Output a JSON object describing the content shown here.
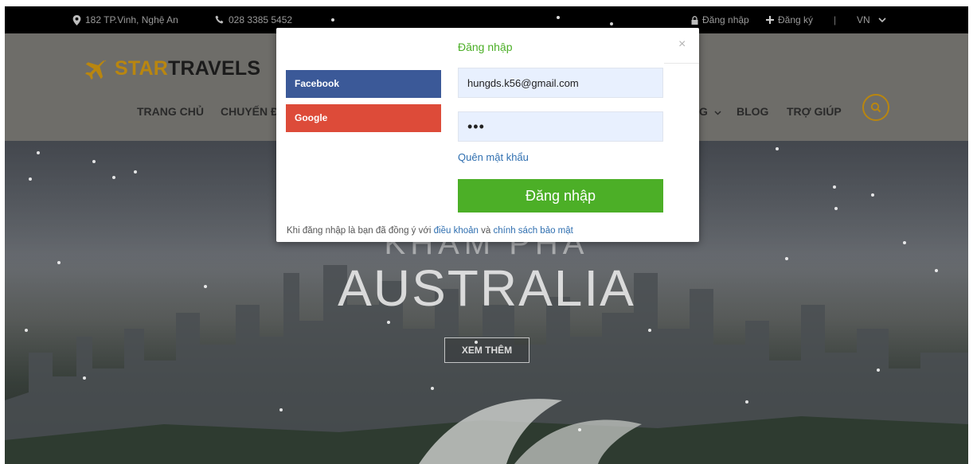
{
  "topbar": {
    "address": "182 TP.Vinh, Nghệ An",
    "phone": "028 3385 5452",
    "login": "Đăng nhập",
    "register": "Đăng ký",
    "separator": "|",
    "language": "VN"
  },
  "header": {
    "logo_part1": "STAR",
    "logo_part2": "TRAVELS",
    "nav": {
      "home": "TRANG CHỦ",
      "tours": "CHUYẾN ĐI",
      "more_fragment": "G",
      "blog": "BLOG",
      "help": "TRỢ GIÚP"
    }
  },
  "hero": {
    "line1": "KHÁM PHÁ",
    "title": "AUSTRALIA",
    "button": "XEM THÊM"
  },
  "modal": {
    "title": "Đăng nhập",
    "close": "×",
    "facebook": "Facebook",
    "google": "Google",
    "email_value": "hungds.k56@gmail.com",
    "password_value": "•••",
    "forgot": "Quên mật khẩu",
    "submit": "Đăng nhập",
    "terms_prefix": "Khi đăng nhập là bạn đã đồng ý với ",
    "terms_link": "điều khoản",
    "terms_and": " và ",
    "privacy_link": "chính sách bảo mật"
  },
  "colors": {
    "brand_green": "#4caf27",
    "brand_gold": "#b9860f",
    "facebook": "#3b5998",
    "google": "#dd4b39",
    "link": "#2f6fb0"
  },
  "icons": [
    "location-pin-icon",
    "phone-icon",
    "lock-icon",
    "plus-icon",
    "chevron-down-icon",
    "airplane-icon",
    "search-icon",
    "close-icon"
  ]
}
